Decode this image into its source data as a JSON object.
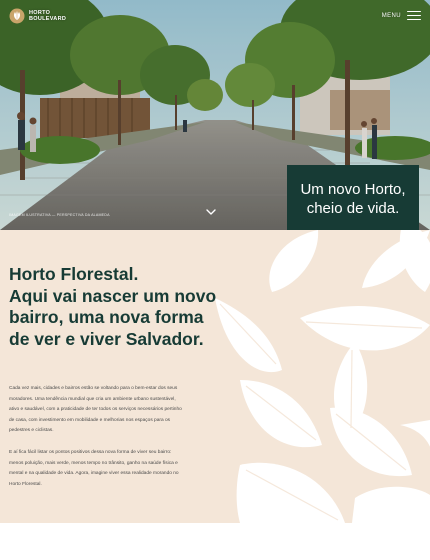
{
  "header": {
    "brand_line1": "HORTO",
    "brand_line2": "BOULEVARD",
    "menu_label": "MENU",
    "logo_icon": "leaf-cluster-logo",
    "menu_icon": "hamburger-icon"
  },
  "hero": {
    "caption": "IMAGEM ILUSTRATIVA — PERSPECTIVA DA ALAMEDA",
    "scroll_icon": "chevron-down-icon",
    "tagline_line1": "Um novo Horto,",
    "tagline_line2": "cheio de vida."
  },
  "intro": {
    "headline_bold": "Horto Florestal.",
    "headline_rest": "Aqui vai nascer um novo bairro, uma nova forma de ver e viver Salvador.",
    "paragraph1": "Cada vez mais, cidades e bairros estão se voltando para o bem-estar dos seus moradores. Uma tendência mundial que cria um ambiente urbano sustentável, ativo e saudável, com a praticidade de ter todos os serviços necessários pertinho de casa, com investimento em mobilidade e melhorias nos espaços para os pedestres e ciclistas.",
    "paragraph2": "E aí fica fácil listar os pontos positivos dessa nova forma de viver seu bairro: menos poluição, mais verde, menos tempo no trânsito, ganho na saúde física e mental e na qualidade de vida. Agora, imagine viver essa realidade morando no Horto Florestal."
  },
  "colors": {
    "brand_dark_green": "#173b35",
    "intro_background": "#f4e6d8",
    "body_text": "#4a4a4a"
  }
}
